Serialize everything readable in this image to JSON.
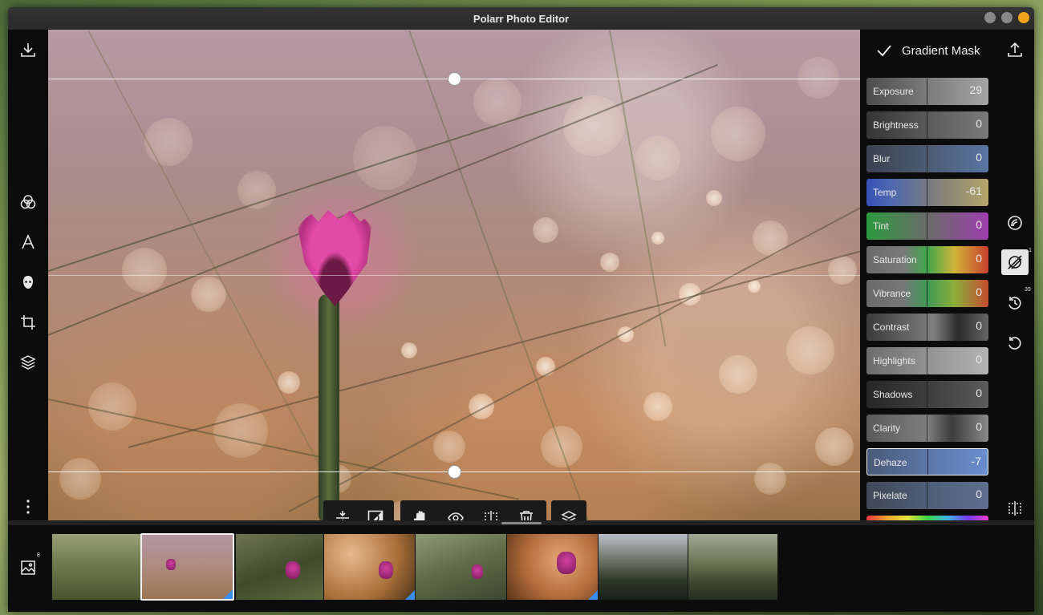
{
  "window": {
    "title": "Polarr Photo Editor",
    "controls": [
      "minimize",
      "maximize",
      "close"
    ],
    "accent_color": "#f2a31b"
  },
  "left_toolbar": {
    "icons": [
      "download-icon",
      "filters-icon",
      "text-icon",
      "face-icon",
      "crop-icon",
      "layers-icon",
      "more-icon"
    ]
  },
  "canvas": {
    "image_description_label": "",
    "floating_toolbar": {
      "groups": [
        [
          "flip-vertical-icon",
          "invert-mask-icon"
        ],
        [
          "pan-hand-icon",
          "eye-icon",
          "compare-icon",
          "trash-icon"
        ],
        [
          "layers-icon"
        ]
      ]
    }
  },
  "panel": {
    "title": "Gradient Mask",
    "sliders": [
      {
        "label": "Exposure",
        "value": "29",
        "bg": "linear-gradient(90deg,#4d4d4d,#7b7b7b 50%,#a5a5a5)"
      },
      {
        "label": "Brightness",
        "value": "0",
        "bg": "linear-gradient(90deg,#353535,#5a5a5a 50%,#7a7a7a)"
      },
      {
        "label": "Blur",
        "value": "0",
        "bg": "linear-gradient(90deg,#3b4250,#4c5b72 50%,#5a75a4)"
      },
      {
        "label": "Temp",
        "value": "-61",
        "bg": "linear-gradient(90deg,#3552b5 0%,#4f68b0 20%,#7c7c7c 55%,#b5a66a)"
      },
      {
        "label": "Tint",
        "value": "0",
        "bg": "linear-gradient(90deg,#2c9a3d,#6b6b6b 50%,#9e3fae)"
      },
      {
        "label": "Saturation",
        "value": "0",
        "bg": "linear-gradient(90deg,#6a6a6a 0%,#7a7a7a 30%,#3fa64a 50%,#d0b43a 72%,#c8402f)"
      },
      {
        "label": "Vibrance",
        "value": "0",
        "bg": "linear-gradient(90deg,#6a6a6a 0%,#777 30%,#3e9a56 50%,#8cae3c 72%,#c44b2f)"
      },
      {
        "label": "Contrast",
        "value": "0",
        "bg": "linear-gradient(90deg,#3a3a3a,#7f7f7f 55%,#2c2c2c 75%,#646464)"
      },
      {
        "label": "Highlights",
        "value": "0",
        "bg": "linear-gradient(90deg,#6c6c6c,#929292 50%,#b4b4b4)"
      },
      {
        "label": "Shadows",
        "value": "0",
        "bg": "linear-gradient(90deg,#272727,#3d3d3d 50%,#5b5b5b)"
      },
      {
        "label": "Clarity",
        "value": "0",
        "bg": "linear-gradient(90deg,#5a5a5a,#7e7e7e 50%,#3c3c3c 70%,#8a8a8a)"
      },
      {
        "label": "Dehaze",
        "value": "-7",
        "bg": "linear-gradient(90deg,#4a5a78,#5b76a8 50%,#6a8fcf)",
        "active": true
      },
      {
        "label": "Pixelate",
        "value": "0",
        "bg": "linear-gradient(90deg,#404857,#4f5d77 50%,#5e6f90)"
      },
      {
        "label": "",
        "value": "",
        "bg": "linear-gradient(90deg,#e8343c,#f0a230,#e8e43c,#3cd646,#3cb4e8,#7a3cf0,#e83cc8)"
      }
    ]
  },
  "right_toolbar": {
    "icons": [
      {
        "name": "export-icon",
        "badge": ""
      },
      {
        "name": "spiral-icon",
        "badge": ""
      },
      {
        "name": "gradient-mask-icon",
        "badge": "1",
        "selected": true
      },
      {
        "name": "history-icon",
        "badge": "39"
      },
      {
        "name": "undo-icon",
        "badge": ""
      },
      {
        "name": "compare-panel-icon",
        "badge": ""
      }
    ]
  },
  "filmstrip": {
    "count_badge": "8",
    "thumbnails": [
      {
        "name": "thumb-1",
        "selected": false,
        "edited": false
      },
      {
        "name": "thumb-2",
        "selected": true,
        "edited": true
      },
      {
        "name": "thumb-3",
        "selected": false,
        "edited": false
      },
      {
        "name": "thumb-4",
        "selected": false,
        "edited": true
      },
      {
        "name": "thumb-5",
        "selected": false,
        "edited": false
      },
      {
        "name": "thumb-6",
        "selected": false,
        "edited": true
      },
      {
        "name": "thumb-7",
        "selected": false,
        "edited": false
      },
      {
        "name": "thumb-8",
        "selected": false,
        "edited": false
      }
    ]
  }
}
